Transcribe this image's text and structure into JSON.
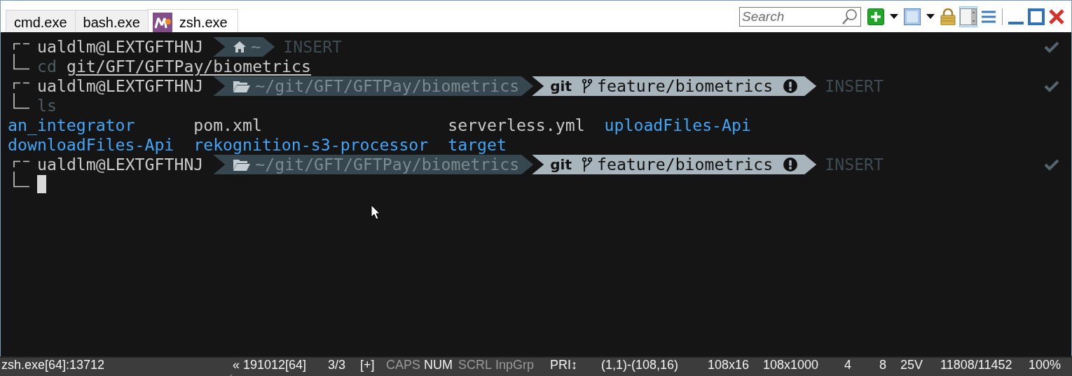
{
  "tabs": [
    {
      "label": "cmd.exe",
      "selected": false,
      "icon": false
    },
    {
      "label": "bash.exe",
      "selected": false,
      "icon": false
    },
    {
      "label": "zsh.exe",
      "selected": true,
      "icon": true
    }
  ],
  "search": {
    "placeholder": "Search"
  },
  "toolbar": [
    {
      "kind": "new-console",
      "pressed": false
    },
    {
      "kind": "caret",
      "pressed": false
    },
    {
      "kind": "console",
      "pressed": false
    },
    {
      "kind": "caret",
      "pressed": false
    },
    {
      "kind": "lock",
      "pressed": false
    },
    {
      "kind": "panel",
      "pressed": true
    },
    {
      "kind": "menu",
      "pressed": false
    },
    {
      "kind": "separator"
    },
    {
      "kind": "minimize",
      "pressed": false
    },
    {
      "kind": "maximize",
      "pressed": false
    },
    {
      "kind": "close",
      "pressed": false
    }
  ],
  "lines": [
    {
      "kind": "prompt",
      "user": "ualdlm@LEXTGFTHNJ",
      "segments": [
        {
          "kind": "home",
          "text": "~"
        }
      ],
      "mode": "INSERT",
      "status_ok": true,
      "command": "cd",
      "argument": "git/GFT/GFTPay/biometrics",
      "cursor": false
    },
    {
      "kind": "prompt",
      "user": "ualdlm@LEXTGFTHNJ",
      "segments": [
        {
          "kind": "dir",
          "text": "~/git/GFT/GFTPay/biometrics"
        },
        {
          "kind": "git",
          "label": "git",
          "branch": "feature/biometrics",
          "dirty": true
        }
      ],
      "mode": "INSERT",
      "status_ok": true,
      "command": "ls",
      "cursor": false
    },
    {
      "kind": "listing",
      "rows": [
        [
          {
            "name": "an_integrator",
            "kind": "dir"
          },
          {
            "name": "pom.xml",
            "kind": "file"
          },
          {
            "name": "serverless.yml",
            "kind": "file"
          },
          {
            "name": "uploadFiles-Api",
            "kind": "dir"
          }
        ],
        [
          {
            "name": "downloadFiles-Api",
            "kind": "dir"
          },
          {
            "name": "rekognition-s3-processor",
            "kind": "dir"
          },
          {
            "name": "target",
            "kind": "dir"
          }
        ]
      ]
    },
    {
      "kind": "prompt",
      "user": "ualdlm@LEXTGFTHNJ",
      "segments": [
        {
          "kind": "dir",
          "text": "~/git/GFT/GFTPay/biometrics"
        },
        {
          "kind": "git",
          "label": "git",
          "branch": "feature/biometrics",
          "dirty": true
        }
      ],
      "mode": "INSERT",
      "status_ok": true,
      "cursor": true
    }
  ],
  "status_bar": {
    "process": "zsh.exe[64]:13712",
    "items": [
      {
        "text": "« 191012[64]",
        "on": true
      },
      {
        "text": "3/3",
        "on": true
      },
      {
        "text": "[+]",
        "on": true
      },
      {
        "text": "CAPS",
        "on": false
      },
      {
        "text": "NUM",
        "on": true
      },
      {
        "text": "SCRL",
        "on": false
      },
      {
        "text": "InpGrp",
        "on": false
      },
      {
        "text": "PRI↕",
        "on": true
      },
      {
        "text": "(1,1)-(108,16)",
        "on": true
      },
      {
        "text": "108x16",
        "on": true
      },
      {
        "text": "108x1000",
        "on": true
      },
      {
        "text": "4",
        "on": true
      },
      {
        "text": "8",
        "on": true
      },
      {
        "text": "25V",
        "on": true
      },
      {
        "text": "11808/11452",
        "on": true
      },
      {
        "text": "100%",
        "on": true
      }
    ]
  }
}
